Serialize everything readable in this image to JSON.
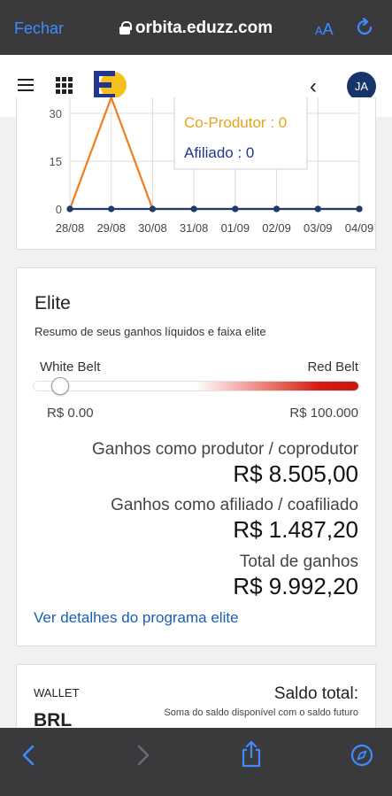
{
  "browser": {
    "close_label": "Fechar",
    "url": "orbita.eduzz.com",
    "text_size_small": "A",
    "text_size_large": "A"
  },
  "header": {
    "avatar_initials": "JA",
    "logo_colors": {
      "blue": "#22358f",
      "yellow": "#f5c21c"
    }
  },
  "chart_data": {
    "type": "line",
    "x": [
      "28/08",
      "29/08",
      "30/08",
      "31/08",
      "01/09",
      "02/09",
      "03/09",
      "04/09"
    ],
    "ytick_labels": [
      "0",
      "15",
      "30"
    ],
    "series": [
      {
        "values": [
          0,
          35,
          0,
          0,
          0,
          0,
          0,
          0
        ],
        "color": "#f07c1b"
      },
      {
        "values": [
          0,
          0,
          0,
          0,
          0,
          0,
          0,
          0
        ],
        "color": "#1f3a6b"
      }
    ],
    "tooltip": {
      "coprodutor": "Co-Produtor : 0",
      "afiliado": "Afiliado : 0"
    }
  },
  "elite": {
    "title": "Elite",
    "subtitle": "Resumo de seus ganhos líquidos e faixa elite",
    "belt_start": "White Belt",
    "belt_end": "Red Belt",
    "range_min": "R$ 0.00",
    "range_max": "R$ 100.000",
    "progress_fraction": 0.085,
    "producer_label": "Ganhos como produtor / coprodutor",
    "producer_value": "R$ 8.505,00",
    "affiliate_label": "Ganhos como afiliado / coafiliado",
    "affiliate_value": "R$ 1.487,20",
    "total_label": "Total de ganhos",
    "total_value": "R$ 9.992,20",
    "details_link": "Ver detalhes do programa elite"
  },
  "wallet": {
    "label": "WALLET",
    "currency": "BRL",
    "balance_title": "Saldo total:",
    "balance_subtitle": "Soma do saldo disponível com o saldo futuro"
  },
  "colors": {
    "browser_blue": "#3d8bff",
    "link": "#1a5fb4",
    "belt_red": "#c7160f"
  }
}
